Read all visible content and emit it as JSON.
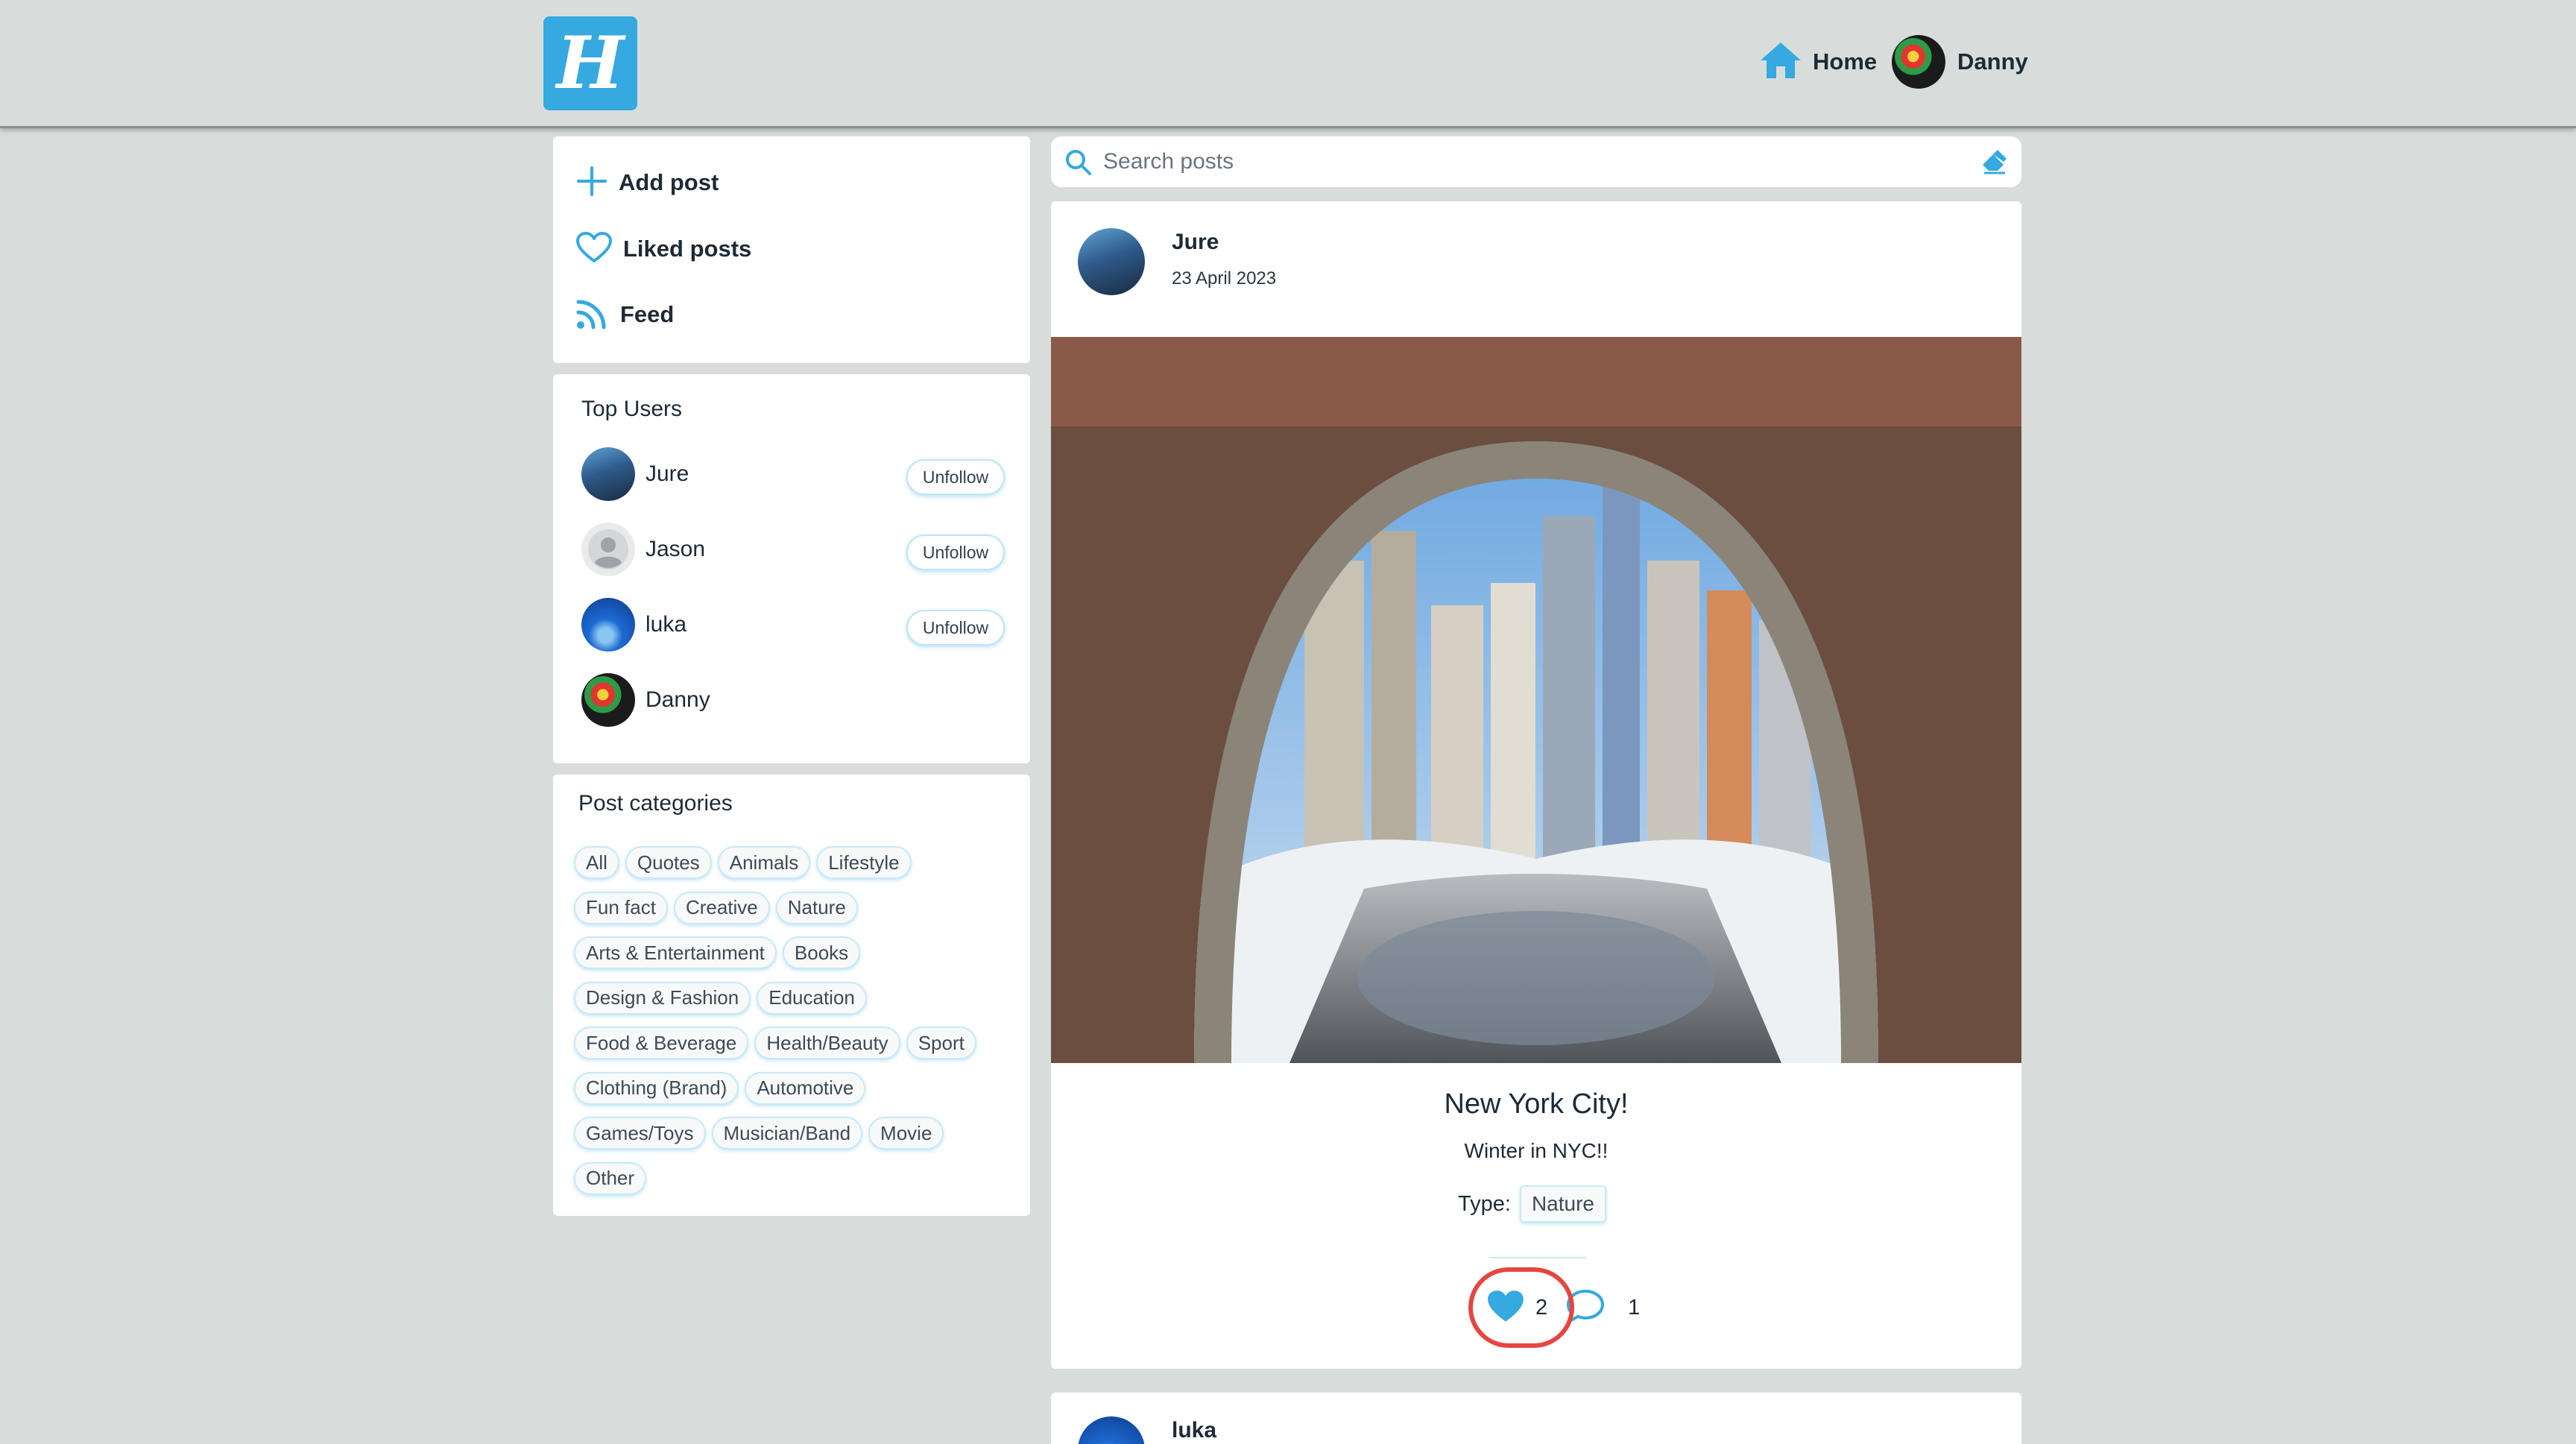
{
  "header": {
    "logo_letter": "H",
    "home_label": "Home",
    "user_name": "Danny"
  },
  "menu": {
    "items": [
      {
        "label": "Add post",
        "icon": "plus-icon"
      },
      {
        "label": "Liked posts",
        "icon": "heart-outline-icon"
      },
      {
        "label": "Feed",
        "icon": "rss-icon"
      }
    ]
  },
  "top_users": {
    "title": "Top Users",
    "users": [
      {
        "name": "Jure",
        "action": "Unfollow"
      },
      {
        "name": "Jason",
        "action": "Unfollow"
      },
      {
        "name": "luka",
        "action": "Unfollow"
      },
      {
        "name": "Danny",
        "action": ""
      }
    ]
  },
  "categories": {
    "title": "Post categories",
    "rows": [
      [
        "All",
        "Quotes",
        "Animals",
        "Lifestyle"
      ],
      [
        "Fun fact",
        "Creative",
        "Nature"
      ],
      [
        "Arts & Entertainment",
        "Books"
      ],
      [
        "Design & Fashion",
        "Education"
      ],
      [
        "Food & Beverage",
        "Health/Beauty",
        "Sport"
      ],
      [
        "Clothing (Brand)",
        "Automotive"
      ],
      [
        "Games/Toys",
        "Musician/Band",
        "Movie"
      ],
      [
        "Other"
      ]
    ]
  },
  "search": {
    "placeholder": "Search posts"
  },
  "post": {
    "author": "Jure",
    "date": "23 April 2023",
    "title": "New York City!",
    "body": "Winter in NYC!!",
    "type_label": "Type:",
    "type_value": "Nature",
    "likes": "2",
    "comments": "1"
  },
  "next_post": {
    "author": "luka"
  },
  "colors": {
    "accent": "#35a9e0",
    "background": "#d8dddc",
    "highlight_ring": "#e5463f"
  }
}
